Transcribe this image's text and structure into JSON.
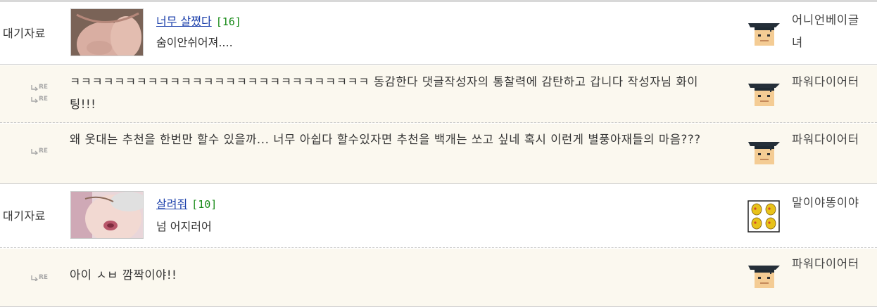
{
  "rows": [
    {
      "type": "post",
      "category": "대기자료",
      "title": "너무 살쪘다",
      "count": "[16]",
      "preview": "숨이안쉬어져....",
      "author": "어니언베이글녀",
      "avatar": "graduate-avatar-icon"
    },
    {
      "type": "reply",
      "re_count": 2,
      "text": "ㅋㅋㅋㅋㅋㅋㅋㅋㅋㅋㅋㅋㅋㅋㅋㅋㅋㅋㅋㅋㅋㅋㅋㅋㅋㅋㅋ 동감한다 댓글작성자의 통찰력에 감탄하고 갑니다 작성자님 화이팅!!!",
      "author": "파워다이어터",
      "avatar": "graduate-avatar-icon"
    },
    {
      "type": "reply",
      "re_count": 1,
      "text": "왜 웃대는 추천을 한번만 할수 있을까... 너무 아쉽다 할수있자면 추천을 백개는 쏘고 싶네 혹시 이런게 별풍아재들의 마음???",
      "author": "파워다이어터",
      "avatar": "graduate-avatar-icon"
    },
    {
      "type": "post",
      "category": "대기자료",
      "title": "살려줘",
      "count": "[10]",
      "preview": "넘 어지러어",
      "author": "말이야똥이야",
      "avatar": "chicks-avatar-icon"
    },
    {
      "type": "reply",
      "re_count": 1,
      "text": "아이 ㅅㅂ 깜짝이야!!",
      "author": "파워다이어터",
      "avatar": "graduate-avatar-icon"
    }
  ],
  "re_label": "RE",
  "colors": {
    "link": "#1a3eaa",
    "count": "#178a17",
    "reply_bg": "#fbf8ef"
  }
}
